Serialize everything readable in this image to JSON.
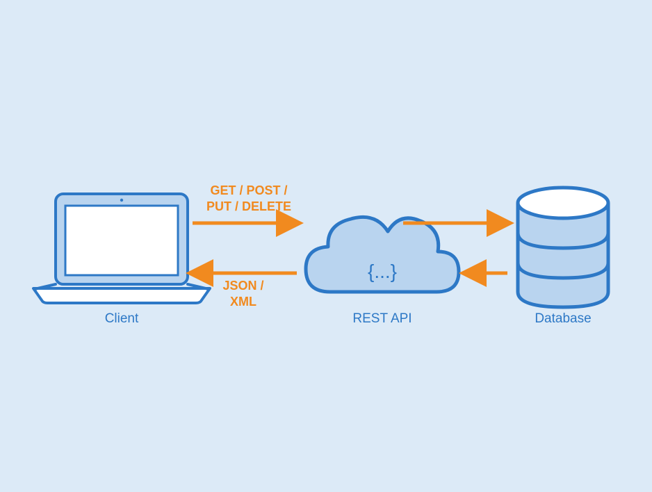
{
  "nodes": {
    "client": {
      "label": "Client"
    },
    "api": {
      "label": "REST API",
      "cloud_text": "{...}"
    },
    "database": {
      "label": "Database"
    }
  },
  "arrows": {
    "request_label_line1": "GET / POST /",
    "request_label_line2": "PUT / DELETE",
    "response_label_line1": "JSON /",
    "response_label_line2": "XML"
  },
  "colors": {
    "background": "#dceaf7",
    "stroke_blue": "#2d78c6",
    "fill_light_blue": "#b9d4ef",
    "arrow_orange": "#f18a1f",
    "white": "#ffffff"
  }
}
